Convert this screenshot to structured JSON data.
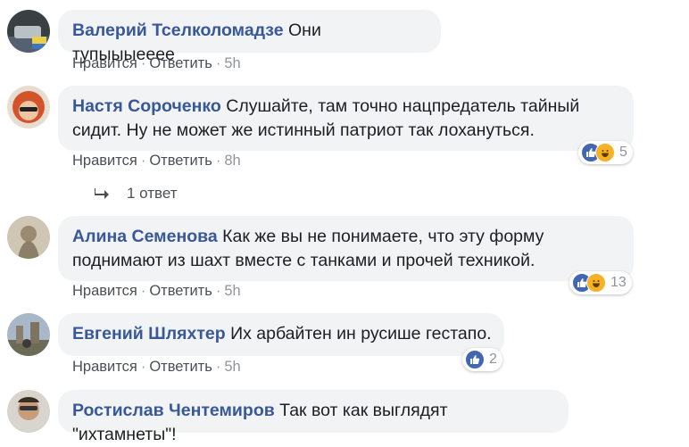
{
  "comments": [
    {
      "author": "Валерий Тселколомадзе",
      "text": "Они тупыыыееее",
      "like_label": "Нравится",
      "reply_label": "Ответить",
      "time": "5h"
    },
    {
      "author": "Настя Сороченко",
      "text": "Слушайте, там точно нацпредатель тайный",
      "text2": "сидит. Ну не может же истинный патриот так лохануться.",
      "like_label": "Нравится",
      "reply_label": "Ответить",
      "time": "8h",
      "reactions": {
        "icons": [
          "like-icon",
          "haha-icon"
        ],
        "count": "5"
      },
      "replies_label": "1 ответ"
    },
    {
      "author": "Алина Семенова",
      "text": "Как же вы не понимаете, что эту форму",
      "text2": "поднимают из шахт вместе с танками и прочей техникой.",
      "like_label": "Нравится",
      "reply_label": "Ответить",
      "time": "5h",
      "reactions": {
        "icons": [
          "like-icon",
          "haha-icon"
        ],
        "count": "13"
      }
    },
    {
      "author": "Евгений Шляхтер",
      "text": "Их арбайтен ин русише гестапо.",
      "like_label": "Нравится",
      "reply_label": "Ответить",
      "time": "5h",
      "reactions": {
        "icons": [
          "like-icon"
        ],
        "count": "2"
      }
    },
    {
      "author": "Ростислав Чентемиров",
      "text": "Так вот как выглядят \"ихтамнеты\"!"
    }
  ],
  "colors": {
    "author": "#385898",
    "bubble": "#f2f3f5",
    "meta": "#90949c",
    "like_badge": "#4267b2",
    "haha_badge": "#f7b125"
  }
}
